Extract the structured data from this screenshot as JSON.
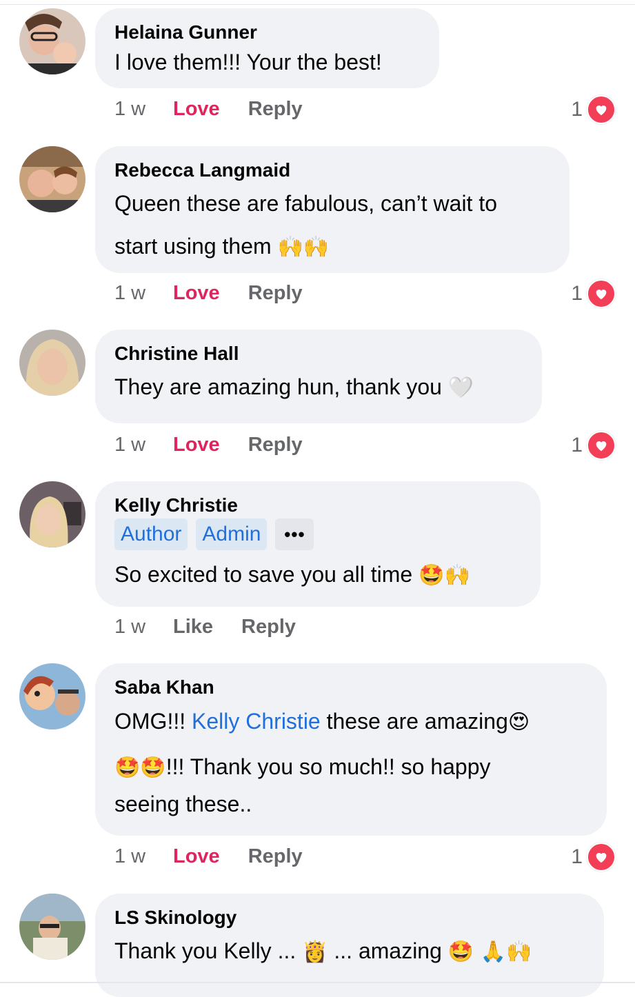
{
  "comments": [
    {
      "author": "Helaina Gunner",
      "text": "I love them!!! Your the best!",
      "time": "1 w",
      "reaction_action": "Love",
      "reply": "Reply",
      "reaction_count": "1"
    },
    {
      "author": "Rebecca Langmaid",
      "text_line1": "Queen these are fabulous, can’t wait to",
      "text_line2": "start  using them",
      "emoji": "🙌🙌",
      "time": "1 w",
      "reaction_action": "Love",
      "reply": "Reply",
      "reaction_count": "1"
    },
    {
      "author": "Christine Hall",
      "text": "They are amazing hun, thank you",
      "emoji": "🤍",
      "time": "1 w",
      "reaction_action": "Love",
      "reply": "Reply",
      "reaction_count": "1"
    },
    {
      "author": "Kelly Christie",
      "badges": [
        "Author",
        "Admin"
      ],
      "more": "•••",
      "text": "So excited to save you all time",
      "emoji": "🤩🙌",
      "time": "1 w",
      "reaction_action": "Like",
      "reply": "Reply"
    },
    {
      "author": "Saba Khan",
      "text_prefix": "OMG!!! ",
      "mention": "Kelly Christie",
      "text_suffix": " these are amazing",
      "emoji_a": "😍",
      "emoji_b": "🤩🤩",
      "text_line2": "!!! Thank you so much!! so happy",
      "text_line3": "seeing these..",
      "time": "1 w",
      "reaction_action": "Love",
      "reply": "Reply",
      "reaction_count": "1"
    },
    {
      "author": "LS Skinology",
      "text_a": "Thank you Kelly ... ",
      "emoji_a": "👸",
      "text_b": " ... amazing ",
      "emoji_b": "🤩 🙏🙌"
    }
  ],
  "colors": {
    "bubble": "#f0f2f5",
    "love": "#e0245e",
    "mention": "#216fdb",
    "badge_bg": "#dbe7f2",
    "heart": "#f33e58",
    "meta": "#65676b"
  },
  "icons": {
    "reaction": "heart-icon",
    "more": "more-options-icon"
  }
}
